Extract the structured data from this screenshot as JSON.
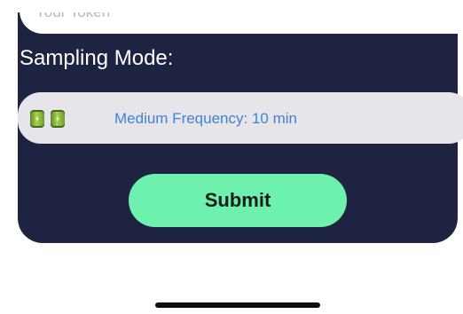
{
  "token_field": {
    "placeholder": "Your Token"
  },
  "sampling": {
    "label": "Sampling Mode:",
    "selected_value": "Medium Frequency: 10 min",
    "icons": [
      "battery-icon",
      "battery-icon"
    ]
  },
  "submit": {
    "label": "Submit"
  },
  "colors": {
    "card_background": "#1f2342",
    "picker_background": "#e8e5ea",
    "accent_text": "#3c85d1",
    "submit_background": "#6ef1ad"
  }
}
